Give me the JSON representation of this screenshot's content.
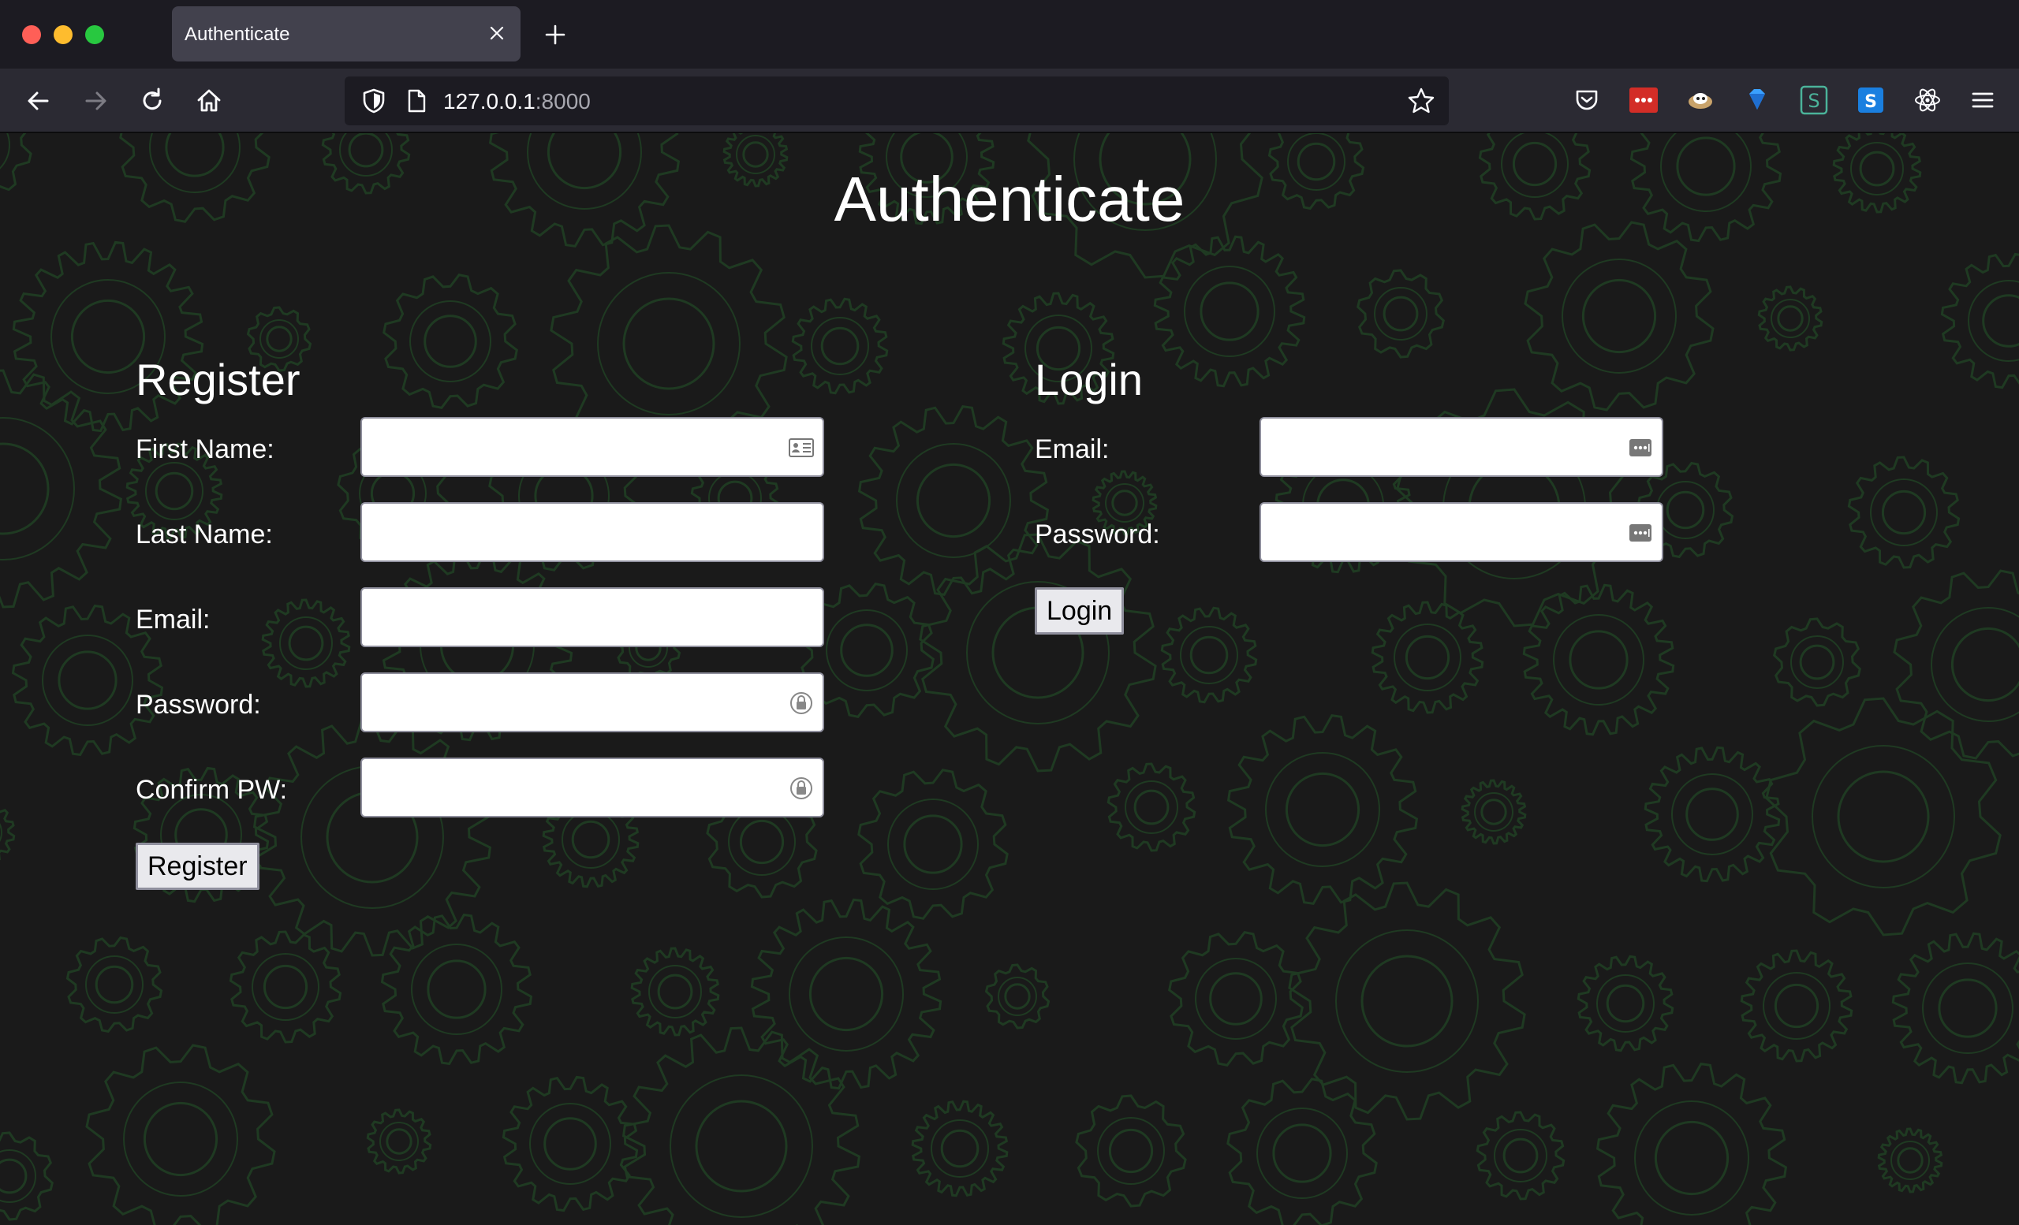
{
  "browser": {
    "tab_title": "Authenticate",
    "url_host": "127.0.0.1",
    "url_port": ":8000"
  },
  "page": {
    "title": "Authenticate"
  },
  "register": {
    "heading": "Register",
    "first_name_label": "First Name:",
    "last_name_label": "Last Name:",
    "email_label": "Email:",
    "password_label": "Password:",
    "confirm_label": "Confirm PW:",
    "button_label": "Register"
  },
  "login": {
    "heading": "Login",
    "email_label": "Email:",
    "password_label": "Password:",
    "button_label": "Login"
  },
  "colors": {
    "page_bg": "#1a1a1a",
    "gear_stroke": "#1f3a22",
    "chrome_bg": "#1c1b22",
    "toolbar_bg": "#2b2a33"
  }
}
